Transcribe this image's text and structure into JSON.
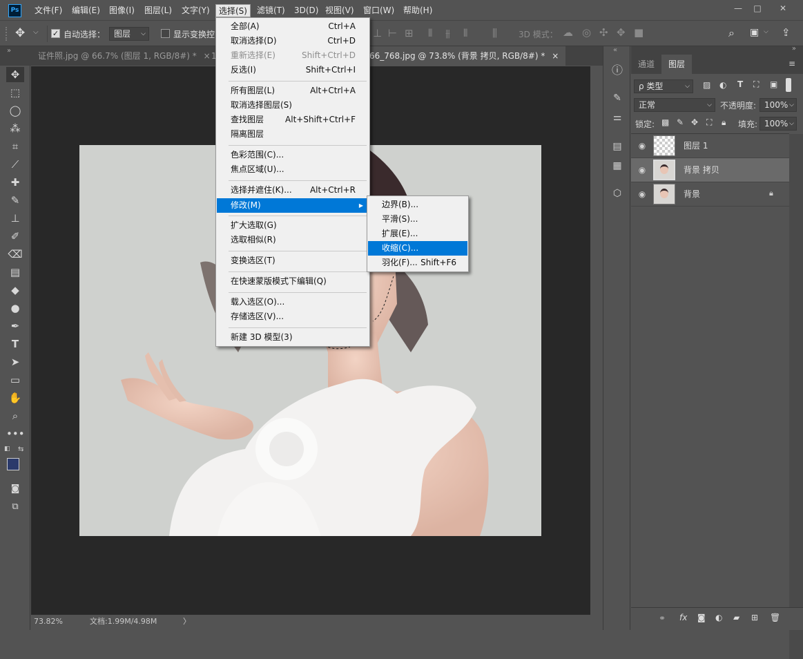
{
  "app": {
    "logo": "Ps"
  },
  "menubar": [
    "文件(F)",
    "编辑(E)",
    "图像(I)",
    "图层(L)",
    "文字(Y)",
    "选择(S)",
    "滤镜(T)",
    "3D(D)",
    "视图(V)",
    "窗口(W)",
    "帮助(H)"
  ],
  "window_controls": {
    "minimize": "—",
    "restore": "□",
    "close": "✕"
  },
  "options": {
    "auto_select_label": "自动选择：",
    "auto_select_value": "图层",
    "show_transform_label": "显示变换控",
    "mode_3d_label": "3D 模式："
  },
  "tabs": [
    {
      "label": "证件照.jpg @ 66.7% (图层 1, RGB/8#) *",
      "close": "×"
    },
    {
      "label": "1",
      "close": ""
    },
    {
      "label": "66_768.jpg @ 73.8% (背景 拷贝, RGB/8#) *",
      "close": "×"
    }
  ],
  "status": {
    "zoom": "73.82%",
    "doc": "文档:1.99M/4.98M",
    "arrow": "〉"
  },
  "panel": {
    "tabs": [
      "通道",
      "图层"
    ],
    "filter_label": "ρ 类型",
    "blend_mode": "正常",
    "opacity_label": "不透明度:",
    "opacity_value": "100%",
    "lock_label": "锁定:",
    "fill_label": "填充:",
    "fill_value": "100%",
    "layers": [
      "图层 1",
      "背景 拷贝",
      "背景"
    ]
  },
  "select_menu": {
    "items": [
      {
        "label": "全部(A)",
        "shortcut": "Ctrl+A"
      },
      {
        "label": "取消选择(D)",
        "shortcut": "Ctrl+D"
      },
      {
        "label": "重新选择(E)",
        "shortcut": "Shift+Ctrl+D"
      },
      {
        "label": "反选(I)",
        "shortcut": "Shift+Ctrl+I"
      },
      {
        "label": "所有图层(L)",
        "shortcut": "Alt+Ctrl+A"
      },
      {
        "label": "取消选择图层(S)",
        "shortcut": ""
      },
      {
        "label": "查找图层",
        "shortcut": "Alt+Shift+Ctrl+F"
      },
      {
        "label": "隔离图层",
        "shortcut": ""
      },
      {
        "label": "色彩范围(C)...",
        "shortcut": ""
      },
      {
        "label": "焦点区域(U)...",
        "shortcut": ""
      },
      {
        "label": "选择并遮住(K)...",
        "shortcut": "Alt+Ctrl+R"
      },
      {
        "label": "修改(M)",
        "shortcut": ""
      },
      {
        "label": "扩大选取(G)",
        "shortcut": ""
      },
      {
        "label": "选取相似(R)",
        "shortcut": ""
      },
      {
        "label": "变换选区(T)",
        "shortcut": ""
      },
      {
        "label": "在快速蒙版模式下编辑(Q)",
        "shortcut": ""
      },
      {
        "label": "载入选区(O)...",
        "shortcut": ""
      },
      {
        "label": "存储选区(V)...",
        "shortcut": ""
      },
      {
        "label": "新建 3D 模型(3)",
        "shortcut": ""
      }
    ]
  },
  "modify_submenu": {
    "items": [
      {
        "label": "边界(B)...",
        "shortcut": ""
      },
      {
        "label": "平滑(S)...",
        "shortcut": ""
      },
      {
        "label": "扩展(E)...",
        "shortcut": ""
      },
      {
        "label": "收缩(C)...",
        "shortcut": ""
      },
      {
        "label": "羽化(F)...",
        "shortcut": "Shift+F6"
      }
    ]
  },
  "colors": {
    "accent": "#0078d7",
    "foreground": "#2b3a6b",
    "background": "#000000"
  }
}
